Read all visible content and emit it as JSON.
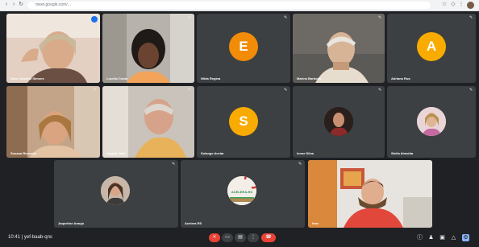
{
  "browser": {
    "url": "meet.google.com/..."
  },
  "participants": [
    {
      "name": "Jane Carolina Simoes"
    },
    {
      "name": "Lucelia Costa"
    },
    {
      "name": "Nilda Regina",
      "initial": "E"
    },
    {
      "name": "Marina Barbosa"
    },
    {
      "name": "Adriana Rua",
      "initial": "A"
    },
    {
      "name": "Susana Rezende"
    },
    {
      "name": "Angela Ortiz"
    },
    {
      "name": "Solange Avelar",
      "initial": "S"
    },
    {
      "name": "Ivone Silva"
    },
    {
      "name": "Stella Almeida"
    },
    {
      "name": "Jaqueline Araujo"
    },
    {
      "name": "Acelera RS",
      "logo_text": "ACELERA-RS"
    },
    {
      "name": "Ivan"
    }
  ],
  "controls": {
    "time_meeting": "10:41 | yef-baab-qns"
  },
  "colors": {
    "tile_bg": "#3c4043",
    "end_call": "#ea4335",
    "avatar_orange": "#f28b06",
    "avatar_yellow": "#f9ab00"
  }
}
